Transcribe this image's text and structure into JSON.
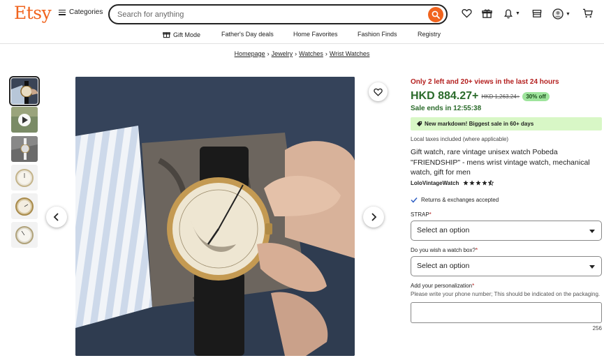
{
  "header": {
    "logo": "Etsy",
    "categories_label": "Categories",
    "search_placeholder": "Search for anything"
  },
  "subnav": {
    "items": [
      "Gift Mode",
      "Father's Day deals",
      "Home Favorites",
      "Fashion Finds",
      "Registry"
    ]
  },
  "breadcrumb": [
    "Homepage",
    "Jewelry",
    "Watches",
    "Wrist Watches"
  ],
  "gallery": {
    "thumbnail_count": 6,
    "active_index": 0
  },
  "listing": {
    "urgency": "Only 2 left and 20+ views in the last 24 hours",
    "price": "HKD 884.27+",
    "old_price": "HKD 1,263.24+",
    "discount": "30% off",
    "sale_ends": "Sale ends in 12:55:38",
    "markdown": "New markdown! Biggest sale in 60+ days",
    "taxes": "Local taxes included (where applicable)",
    "title": "Gift watch, rare vintage unisex watch Pobeda \"FRIENDSHIP\" - mens wrist vintage watch, mechanical watch, gift for men",
    "shop_name": "LoloVintageWatch",
    "rating": 4.5,
    "returns": "Returns & exchanges accepted"
  },
  "options": {
    "strap_label": "STRAP",
    "strap_value": "Select an option",
    "box_label": "Do you wish a watch box?",
    "box_value": "Select an option",
    "personalization_label": "Add your personalization",
    "personalization_help": "Please write your phone number; This should be indicated on the packaging.",
    "char_count": "256"
  },
  "colors": {
    "brand": "#f1641e",
    "price_green": "#2a6a2a",
    "urgency_red": "#b4201f",
    "discount_bg": "#9ee49c",
    "markdown_bg": "#d8f7c6"
  },
  "icons": [
    "hamburger-icon",
    "search-icon",
    "heart-icon",
    "gift-icon",
    "bell-icon",
    "shop-icon",
    "avatar-icon",
    "cart-icon",
    "play-icon",
    "chevron-left-icon",
    "chevron-right-icon",
    "star-icon",
    "check-icon",
    "tag-icon"
  ]
}
